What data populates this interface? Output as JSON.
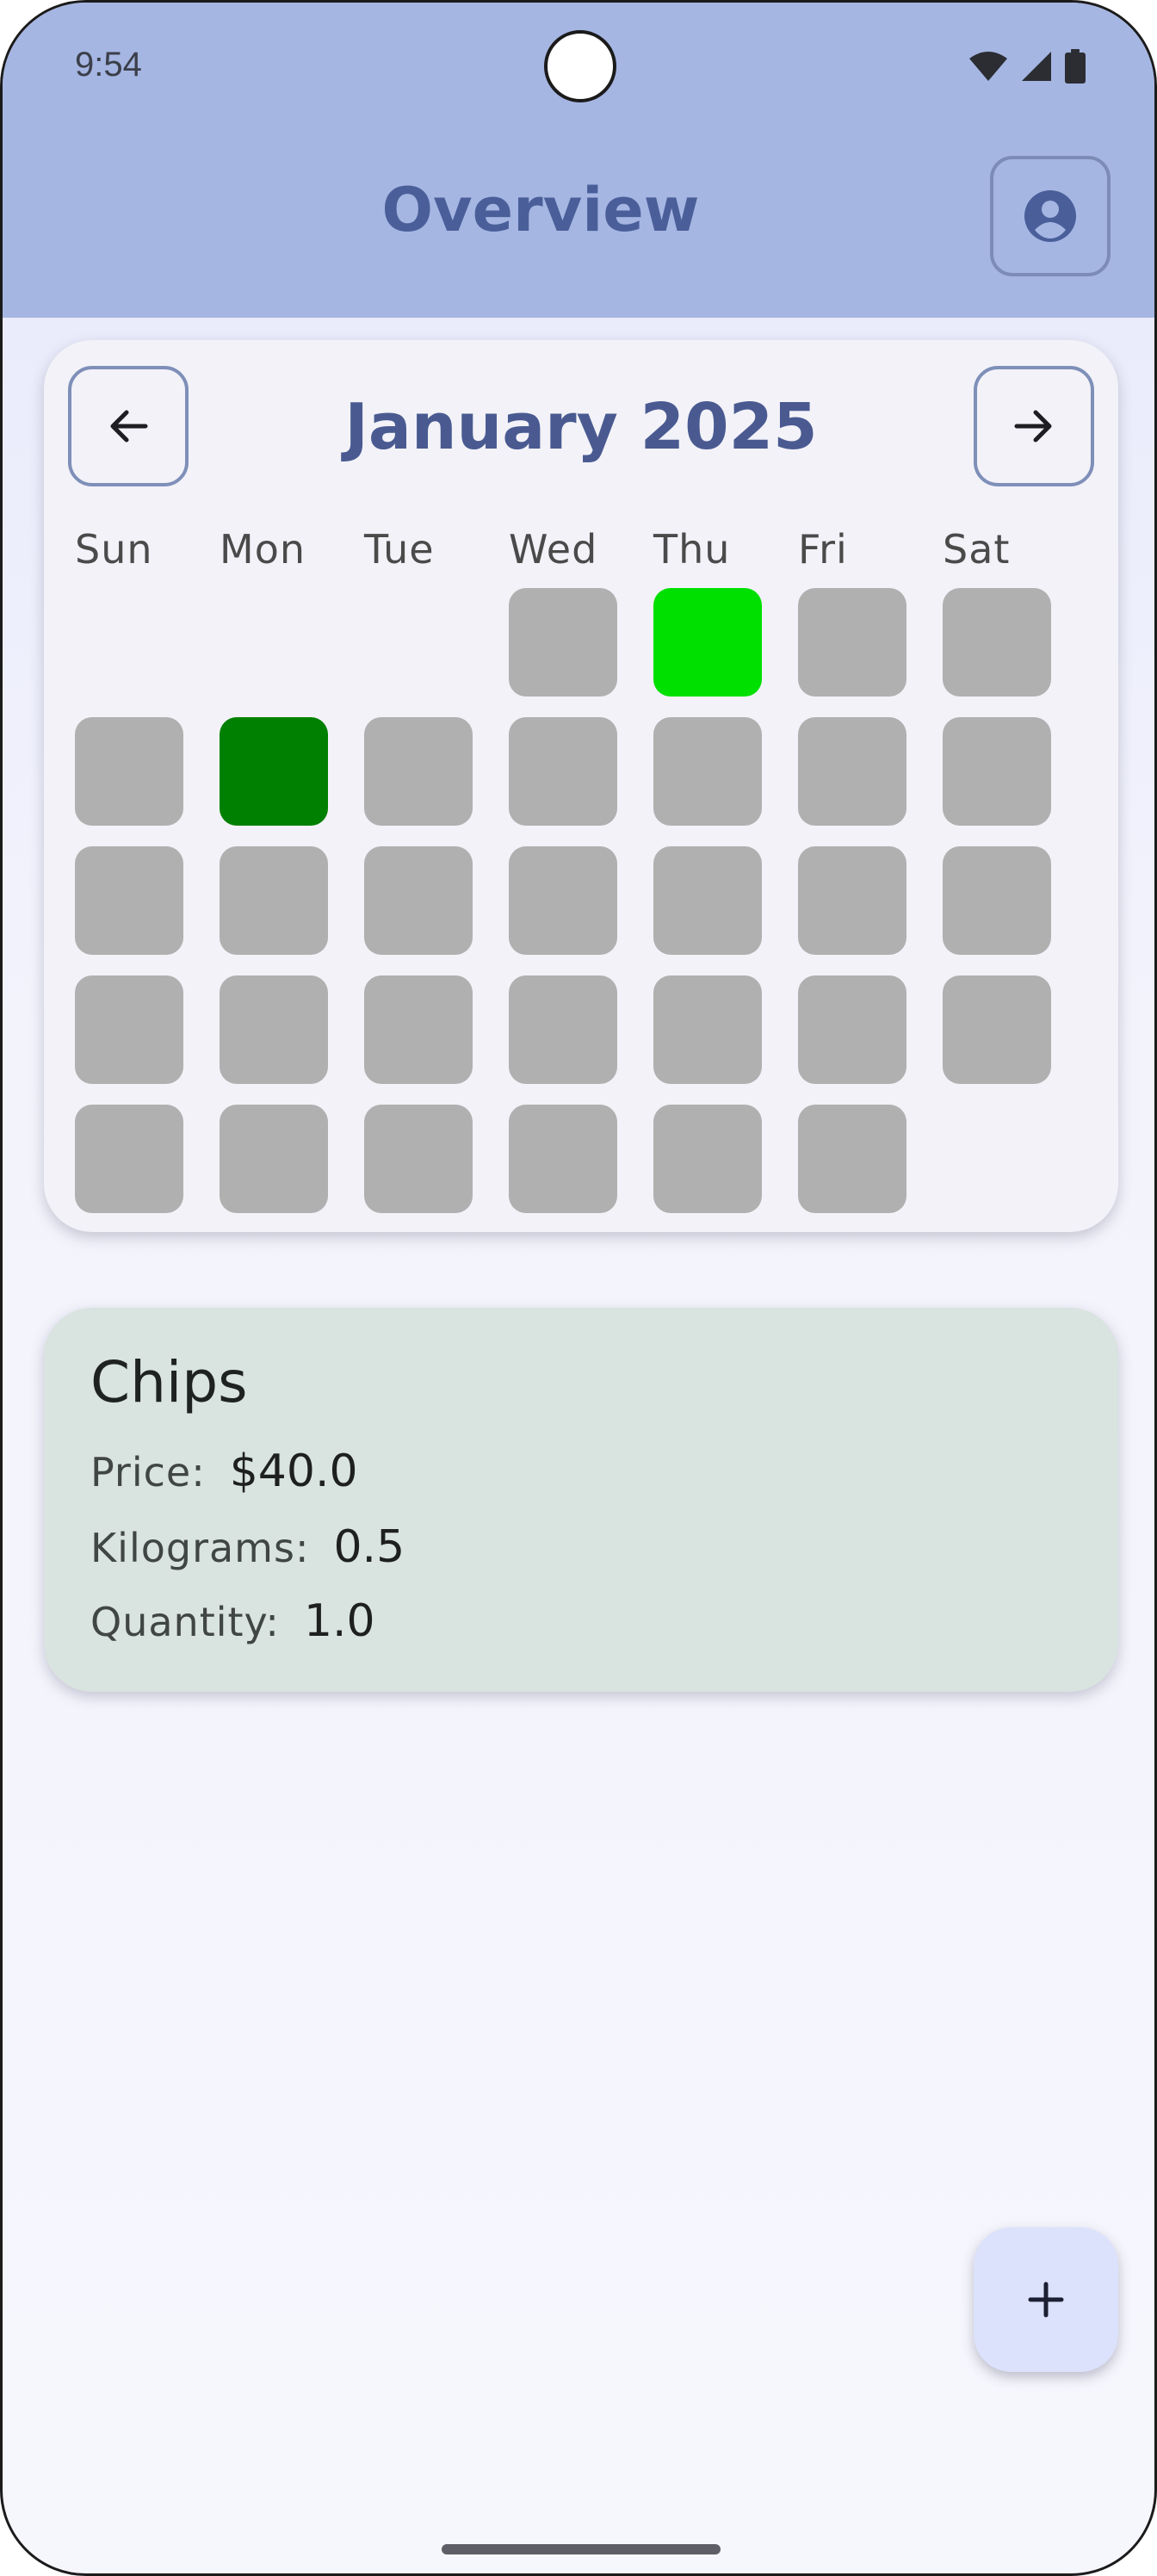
{
  "status_bar": {
    "time": "9:54",
    "icons": [
      "wifi-icon",
      "signal-icon",
      "battery-icon"
    ]
  },
  "app_bar": {
    "title": "Overview",
    "profile_icon": "account-circle-icon"
  },
  "calendar": {
    "month_label": "January 2025",
    "prev_icon": "arrow-left-icon",
    "next_icon": "arrow-right-icon",
    "weekdays": [
      "Sun",
      "Mon",
      "Tue",
      "Wed",
      "Thu",
      "Fri",
      "Sat"
    ],
    "first_weekday_index": 3,
    "days_in_month": 31,
    "highlighted_days": [
      {
        "day": 2,
        "color": "#00e000"
      },
      {
        "day": 6,
        "color": "#008000"
      }
    ],
    "default_day_color": "#b0b0b0"
  },
  "item": {
    "name": "Chips",
    "price_label": "Price:",
    "price_value": "$40.0",
    "kg_label": "Kilograms:",
    "kg_value": "0.5",
    "qty_label": "Quantity:",
    "qty_value": "1.0"
  },
  "fab": {
    "icon": "plus-icon",
    "label": "+"
  },
  "colors": {
    "app_bar": "#a6b6e2",
    "accent": "#4a5f9a",
    "item_card": "#d9e3df",
    "fab": "#dce2fb"
  }
}
